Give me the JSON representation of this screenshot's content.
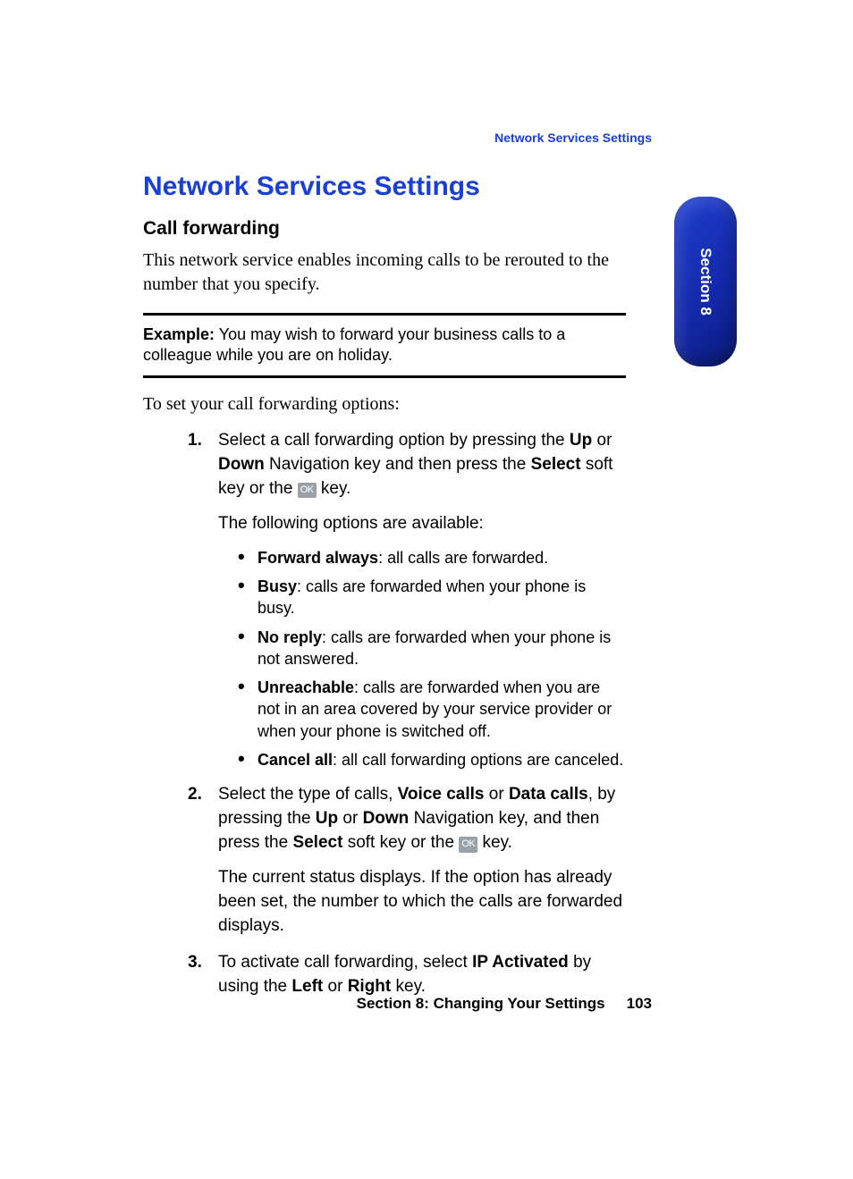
{
  "running_head": "Network Services Settings",
  "title": "Network Services Settings",
  "subhead": "Call forwarding",
  "intro": "This network service enables incoming calls to be rerouted to the number that you specify.",
  "example": {
    "label": "Example:",
    "text": " You may wish to forward your business calls to a colleague while you are on holiday."
  },
  "lead": "To set your call forwarding options:",
  "step1": {
    "p1a": "Select a call forwarding option by pressing the ",
    "up": "Up",
    "p1b": " or ",
    "down": "Down",
    "p1c": " Navigation key and then press the ",
    "select": "Select",
    "p1d": " soft key or the ",
    "ok": "OK",
    "p1e": " key.",
    "p2": "The following options are available:",
    "opts": [
      {
        "name": "Forward always",
        "desc": ": all calls are forwarded."
      },
      {
        "name": "Busy",
        "desc": ": calls are forwarded when your phone is busy."
      },
      {
        "name": "No reply",
        "desc": ": calls are forwarded when your phone is not answered."
      },
      {
        "name": "Unreachable",
        "desc": ": calls are forwarded when you are not in an area covered by your service provider or when your phone is switched off."
      },
      {
        "name": "Cancel all",
        "desc": ": all call forwarding options are canceled."
      }
    ]
  },
  "step2": {
    "a": "Select the type of calls, ",
    "voice": "Voice calls",
    "b": " or ",
    "data": "Data calls",
    "c": ", by pressing the ",
    "up": "Up",
    "d": " or ",
    "down": "Down",
    "e": " Navigation key, and then press the ",
    "select": "Select",
    "f": " soft key or the ",
    "ok": "OK",
    "g": " key.",
    "p2": "The current status displays. If the option has already been set, the number to which the calls are forwarded displays."
  },
  "step3": {
    "a": "To activate call forwarding, select ",
    "ip": "IP Activated",
    "b": " by using the ",
    "left": "Left",
    "c": " or ",
    "right": "Right",
    "d": " key."
  },
  "footer": {
    "section": "Section 8: Changing Your Settings",
    "page": "103"
  },
  "side_tab": "Section 8"
}
